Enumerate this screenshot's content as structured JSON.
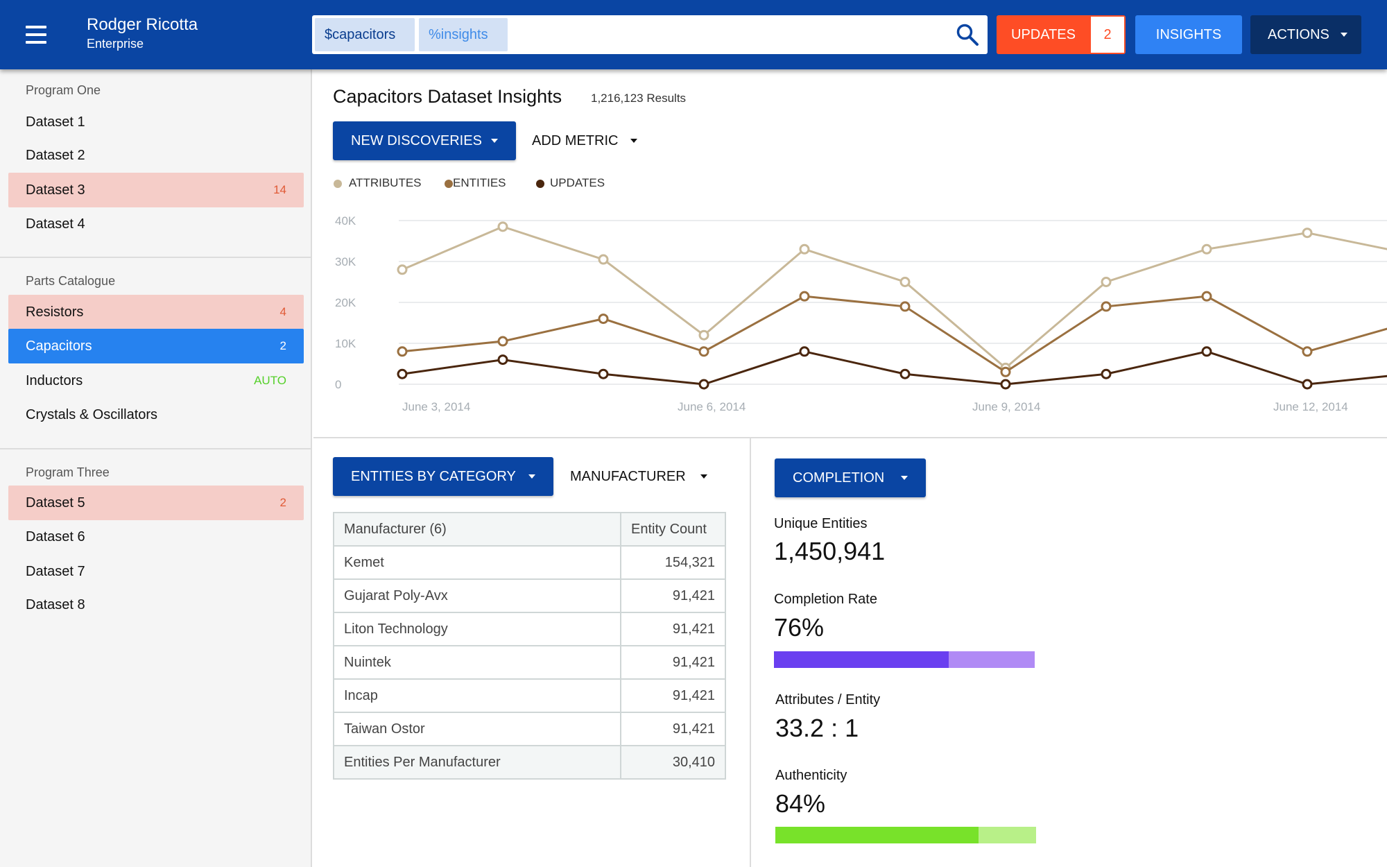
{
  "header": {
    "user_name": "Rodger Ricotta",
    "user_org": "Enterprise",
    "search_chips": [
      "$capacitors",
      "%insights"
    ],
    "updates_label": "UPDATES",
    "updates_count": "2",
    "insights_label": "INSIGHTS",
    "actions_label": "ACTIONS",
    "colors": {
      "header_bg": "#0a45a3",
      "updates_bg": "#fe4d25",
      "insights_bg": "#2f82f4",
      "actions_bg": "#0a2f66"
    }
  },
  "sidebar": {
    "sections": [
      {
        "title": "Program One",
        "items": [
          {
            "label": "Dataset 1",
            "badge": ""
          },
          {
            "label": "Dataset 2",
            "badge": ""
          },
          {
            "label": "Dataset 3",
            "badge": "14",
            "state": "warn"
          },
          {
            "label": "Dataset 4",
            "badge": ""
          }
        ]
      },
      {
        "title": "Parts Catalogue",
        "items": [
          {
            "label": "Resistors",
            "badge": "4",
            "state": "warn"
          },
          {
            "label": "Capacitors",
            "badge": "2",
            "state": "active"
          },
          {
            "label": "Inductors",
            "badge": "AUTO",
            "state": "auto"
          },
          {
            "label": "Crystals & Oscillators",
            "badge": ""
          }
        ]
      },
      {
        "title": "Program Three",
        "items": [
          {
            "label": "Dataset 5",
            "badge": "2",
            "state": "warn"
          },
          {
            "label": "Dataset 6",
            "badge": ""
          },
          {
            "label": "Dataset 7",
            "badge": ""
          },
          {
            "label": "Dataset 8",
            "badge": ""
          }
        ]
      }
    ]
  },
  "main": {
    "title": "Capacitors Dataset Insights",
    "results": "1,216,123 Results",
    "new_discoveries_label": "NEW DISCOVERIES",
    "add_metric_label": "ADD METRIC"
  },
  "chart_data": {
    "type": "line",
    "x_ticks": [
      "June 3, 2014",
      "June 6, 2014",
      "June 9, 2014",
      "June 12, 2014"
    ],
    "y_ticks": [
      "40K",
      "30K",
      "20K",
      "10K",
      "0"
    ],
    "ylim": [
      0,
      40000
    ],
    "series": [
      {
        "name": "ATTRIBUTES",
        "color": "#c8b898",
        "values": [
          28000,
          38500,
          30500,
          12000,
          33000,
          25000,
          4000,
          25000,
          33000,
          37000,
          32000
        ]
      },
      {
        "name": "ENTITIES",
        "color": "#9a7040",
        "values": [
          8000,
          10500,
          16000,
          8000,
          21500,
          19000,
          3000,
          19000,
          21500,
          8000,
          15000
        ]
      },
      {
        "name": "UPDATES",
        "color": "#4a260e",
        "values": [
          2500,
          6000,
          2500,
          0,
          8000,
          2500,
          0,
          2500,
          8000,
          0,
          2500
        ]
      }
    ],
    "grid": true,
    "legend": "top-left"
  },
  "entities": {
    "category_label": "ENTITIES BY CATEGORY",
    "manufacturer_label": "MANUFACTURER",
    "table": {
      "headers": [
        "Manufacturer (6)",
        "Entity Count"
      ],
      "rows": [
        [
          "Kemet",
          "154,321"
        ],
        [
          "Gujarat Poly-Avx",
          "91,421"
        ],
        [
          "Liton Technology",
          "91,421"
        ],
        [
          "Nuintek",
          "91,421"
        ],
        [
          "Incap",
          "91,421"
        ],
        [
          "Taiwan Ostor",
          "91,421"
        ]
      ],
      "footer": [
        "Entities Per Manufacturer",
        "30,410"
      ]
    }
  },
  "completion": {
    "label": "COMPLETION",
    "unique_entities_label": "Unique Entities",
    "unique_entities": "1,450,941",
    "completion_rate_label": "Completion Rate",
    "completion_rate": "76%",
    "completion_rate_fraction": 0.67,
    "attr_entity_label": "Attributes / Entity",
    "attr_entity": "33.2 : 1",
    "authenticity_label": "Authenticity",
    "authenticity": "84%",
    "authenticity_fraction": 0.78,
    "colors": {
      "rate_fill": "#6a3ff0",
      "rate_track": "#b08af5",
      "auth_fill": "#78e22a",
      "auth_track": "#b8f088"
    }
  }
}
